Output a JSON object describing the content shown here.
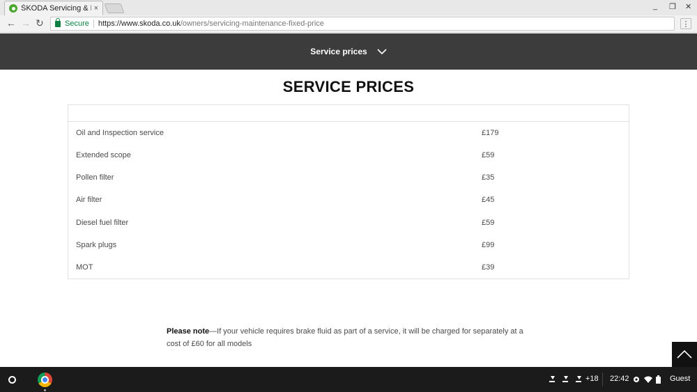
{
  "browser": {
    "tab_title": "ŠKODA Servicing & Maint",
    "tab_close": "×",
    "window_minimize": "_",
    "window_restore": "❐",
    "window_close": "✕",
    "back": "←",
    "forward": "→",
    "reload": "↻",
    "secure_label": "Secure",
    "url_host": "https://www.skoda.co.uk",
    "url_path": "/owners/servicing-maintenance-fixed-price",
    "menu": "⋮"
  },
  "site_nav": {
    "label": "Service prices"
  },
  "page": {
    "title": "SERVICE PRICES",
    "prices": [
      {
        "name": "Oil and Inspection service",
        "price": "£179"
      },
      {
        "name": "Extended scope",
        "price": "£59"
      },
      {
        "name": "Pollen filter",
        "price": "£35"
      },
      {
        "name": "Air filter",
        "price": "£45"
      },
      {
        "name": "Diesel fuel filter",
        "price": "£59"
      },
      {
        "name": "Spark plugs",
        "price": "£99"
      },
      {
        "name": "MOT",
        "price": "£39"
      }
    ],
    "note_label": "Please note",
    "note_text": "—If your vehicle requires brake fluid as part of a service, it will be charged for separately at a cost of £60 for all models"
  },
  "taskbar": {
    "notification_count": "+18",
    "time": "22:42",
    "user": "Guest"
  },
  "icons": {
    "favicon": "skoda-logo-icon",
    "lock": "lock-icon",
    "chevron": "chevron-down-icon",
    "to_top": "chevron-up-icon"
  },
  "colors": {
    "nav_bar": "#3c3c3c",
    "secure_green": "#0b8043",
    "brand_green": "#4ba82e"
  }
}
